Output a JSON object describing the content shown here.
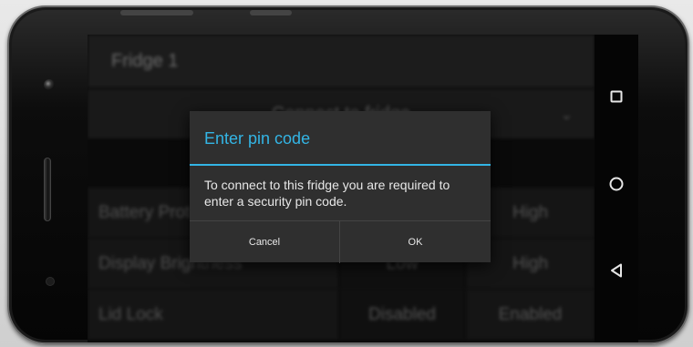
{
  "app": {
    "header_title": "Fridge 1",
    "spinner_label": "Connect to fridge",
    "rows": [
      {
        "label": "Battery Protection",
        "option_low": "",
        "option_high": "High"
      },
      {
        "label": "Display Brightness",
        "option_low": "Low",
        "option_high": "High"
      },
      {
        "label": "Lid Lock",
        "option_low": "Disabled",
        "option_high": "Enabled"
      }
    ]
  },
  "dialog": {
    "title": "Enter pin code",
    "message": "To connect to this fridge you are required to enter a security pin code.",
    "cancel_label": "Cancel",
    "ok_label": "OK"
  },
  "navbar": {
    "items": [
      "recents-icon",
      "home-icon",
      "back-icon"
    ]
  },
  "colors": {
    "accent": "#33b5e5",
    "dialog_bg": "#2f2f2f"
  }
}
